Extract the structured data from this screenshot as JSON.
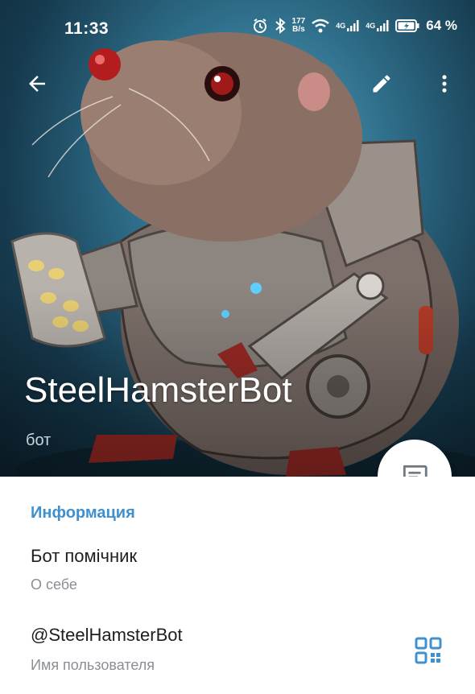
{
  "status_bar": {
    "time": "11:33",
    "speed_value": "177",
    "speed_unit": "B/s",
    "signal_1": "4G",
    "signal_2": "4G",
    "battery": "64 %"
  },
  "profile": {
    "name": "SteelHamsterBot",
    "type": "бот"
  },
  "info": {
    "section_title": "Информация",
    "bio_value": "Бот помічник",
    "bio_label": "О себе",
    "username_value": "@SteelHamsterBot",
    "username_label": "Имя пользователя"
  },
  "colors": {
    "accent": "#3f90cf",
    "hero_bg": "#2f6f8b"
  },
  "icons": {
    "back": "arrow-left-icon",
    "edit": "pencil-icon",
    "more": "dots-vertical-icon",
    "message": "message-icon",
    "qr": "qr-code-icon"
  }
}
